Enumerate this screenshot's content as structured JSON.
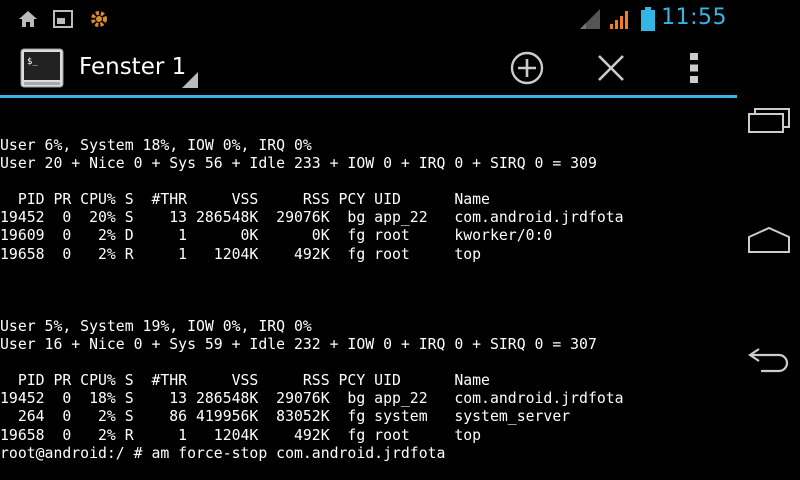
{
  "status_bar": {
    "clock": "11:55",
    "icons": [
      "home-icon",
      "screen-icon",
      "settings-gear-icon",
      "signal-strength-icon",
      "signal-strength-alt-icon",
      "battery-icon"
    ],
    "accent_color": "#33b5e5"
  },
  "action_bar": {
    "title": "Fenster 1",
    "icons": [
      "terminal-app-icon",
      "add-window-icon",
      "close-window-icon",
      "overflow-menu-icon"
    ],
    "accent_color": "#33b5e5"
  },
  "nav_bar": {
    "icons": [
      "recent-apps-icon",
      "home-nav-icon",
      "back-icon"
    ]
  },
  "terminal": {
    "text_color": "#ffffff",
    "background": "#000000",
    "lines": [
      "User 6%, System 18%, IOW 0%, IRQ 0%",
      "User 20 + Nice 0 + Sys 56 + Idle 233 + IOW 0 + IRQ 0 + SIRQ 0 = 309",
      "",
      "  PID PR CPU% S  #THR     VSS     RSS PCY UID      Name",
      "19452  0  20% S    13 286548K  29076K  bg app_22   com.android.jrdfota",
      "19609  0   2% D     1      0K      0K  fg root     kworker/0:0",
      "19658  0   2% R     1   1204K    492K  fg root     top",
      "",
      "",
      "",
      "User 5%, System 19%, IOW 0%, IRQ 0%",
      "User 16 + Nice 0 + Sys 59 + Idle 232 + IOW 0 + IRQ 0 + SIRQ 0 = 307",
      "",
      "  PID PR CPU% S  #THR     VSS     RSS PCY UID      Name",
      "19452  0  18% S    13 286548K  29076K  bg app_22   com.android.jrdfota",
      "  264  0   2% S    86 419956K  83052K  fg system   system_server",
      "19658  0   2% R     1   1204K    492K  fg root     top",
      "root@android:/ # am force-stop com.android.jrdfota"
    ]
  }
}
